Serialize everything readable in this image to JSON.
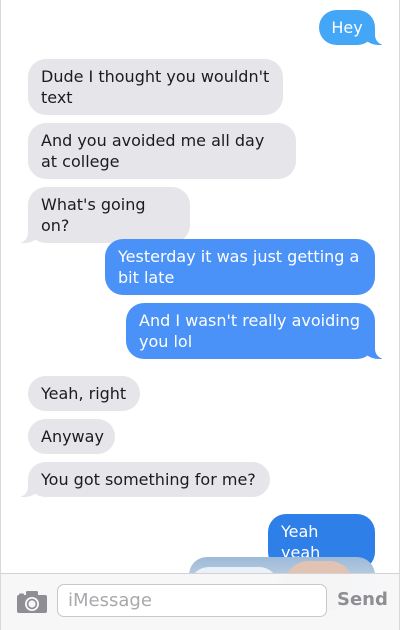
{
  "messages": {
    "m1": "Hey",
    "m2": "Dude I thought you wouldn't text",
    "m3": "And you avoided me all day at college",
    "m4": "What's going on?",
    "m5": "Yesterday it was just getting a bit late",
    "m6": "And I wasn't really avoiding you lol",
    "m7": "Yeah, right",
    "m8": "Anyway",
    "m9": "You got something for me?",
    "m10": "Yeah yeah"
  },
  "input": {
    "placeholder": "iMessage",
    "value": ""
  },
  "send_label": "Send",
  "icons": {
    "camera": "camera-icon"
  },
  "colors": {
    "incoming": "#e5e5ea",
    "outgoing_light": "#43a6f7",
    "outgoing_mid": "#4a92f8",
    "outgoing_dark": "#2f7fe8",
    "send_disabled": "#8e8e93"
  }
}
